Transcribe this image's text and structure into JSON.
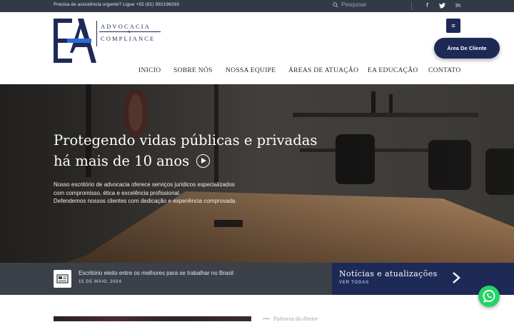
{
  "topbar": {
    "assist_text": "Precisa de assistência urgente? Ligue +55 (81) 992196293",
    "search_placeholder": "Pesquisar",
    "social": [
      {
        "name": "facebook",
        "glyph": "f"
      },
      {
        "name": "twitter",
        "glyph": "🐦"
      },
      {
        "name": "linkedin",
        "glyph": "in"
      }
    ]
  },
  "logo": {
    "mark": "EA",
    "line1": "ADVOCACIA",
    "amp": "&",
    "line2": "COMPLIANCE"
  },
  "header": {
    "menu_icon": "≡",
    "client_button": "Área De Cliente"
  },
  "nav": {
    "items": [
      "INICIO",
      "SOBRE NÓS",
      "NOSSA EQUIPE",
      "ÁREAS DE ATUAÇÃO",
      "EA EDUCAÇÃO",
      "CONTATO"
    ]
  },
  "hero": {
    "title_line1": "Protegendo vidas públicas e privadas",
    "title_line2": "há mais de 10 anos",
    "desc_line1": "Nosso escritório de advocacia oferece serviços jurídicos especializados",
    "desc_line2": "com compromisso, ética e excelência profissional.",
    "desc_line3": "Defendemos nossos clientes com dedicação e experiência comprovada."
  },
  "news": {
    "headline": "Escritório eleito entre os melhores para se trabalhar no Brasil",
    "date": "15 DE MAIO, 2024",
    "box_title": "Notícias e atualizações",
    "box_link": "VER TODAS"
  },
  "bottom": {
    "director_label": "Palavras do diretor"
  },
  "colors": {
    "brand_navy": "#1e2a56",
    "topbar": "#323a45",
    "news_strip": "#3b4049",
    "whatsapp": "#25d366"
  },
  "icons": [
    "search-icon",
    "facebook-icon",
    "twitter-icon",
    "linkedin-icon",
    "menu-icon",
    "play-icon",
    "newspaper-icon",
    "chevron-right-icon",
    "whatsapp-icon"
  ]
}
